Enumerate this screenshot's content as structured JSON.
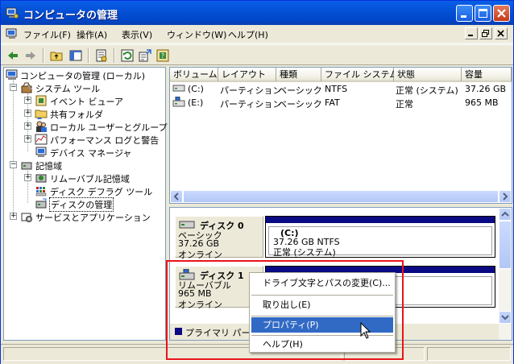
{
  "window": {
    "title": "コンピュータの管理",
    "icon": "computer-management-icon"
  },
  "menubar": {
    "items": [
      "ファイル(F)",
      "操作(A)",
      "表示(V)",
      "ウィンドウ(W)",
      "ヘルプ(H)"
    ]
  },
  "toolbar": {
    "icons": [
      "back-arrow-icon",
      "forward-arrow-icon",
      "up-folder-icon",
      "show-hide-tree-icon",
      "properties-icon",
      "refresh-icon",
      "export-list-icon",
      "help-icon"
    ]
  },
  "tree": {
    "root": "コンピュータの管理 (ローカル)",
    "system_tools": "システム ツール",
    "event_viewer": "イベント ビューア",
    "shared_folders": "共有フォルダ",
    "local_users": "ローカル ユーザーとグループ",
    "performance": "パフォーマンス ログと警告",
    "device_manager": "デバイス マネージャ",
    "storage": "記憶域",
    "removable_storage": "リムーバブル記憶域",
    "defrag": "ディスク デフラグ ツール",
    "disk_management": "ディスクの管理",
    "services": "サービスとアプリケーション"
  },
  "volume_list": {
    "headers": [
      "ボリューム",
      "レイアウト",
      "種類",
      "ファイル システム",
      "状態",
      "容量"
    ],
    "rows": [
      {
        "volume": "(C:)",
        "layout": "パーティション",
        "type": "ベーシック",
        "fs": "NTFS",
        "status": "正常 (システム)",
        "capacity": "37.26 GB"
      },
      {
        "volume": "(E:)",
        "layout": "パーティション",
        "type": "ベーシック",
        "fs": "FAT",
        "status": "正常",
        "capacity": "965 MB"
      }
    ]
  },
  "disks": [
    {
      "name": "ディスク 0",
      "kind": "ベーシック",
      "size": "37.26 GB",
      "state": "オンライン",
      "volume": {
        "label": "(C:)",
        "detail": "37.26 GB NTFS",
        "status": "正常 (システム)"
      }
    },
    {
      "name": "ディスク 1",
      "kind": "リムーバブル",
      "size": "965 MB",
      "state": "オンライン"
    }
  ],
  "legend": {
    "primary_partition": "プライマリ パーテ",
    "color": "#0a0a84"
  },
  "context_menu": {
    "items": [
      "ドライブ文字とパスの変更(C)...",
      "取り出し(E)",
      "プロパティ(P)",
      "ヘルプ(H)"
    ],
    "highlighted_index": 2
  },
  "colors": {
    "titlebar": "#0350d4",
    "highlight": "#316ac5",
    "annotation_box": "#e8141b",
    "primary_bar": "#0a0a84"
  }
}
